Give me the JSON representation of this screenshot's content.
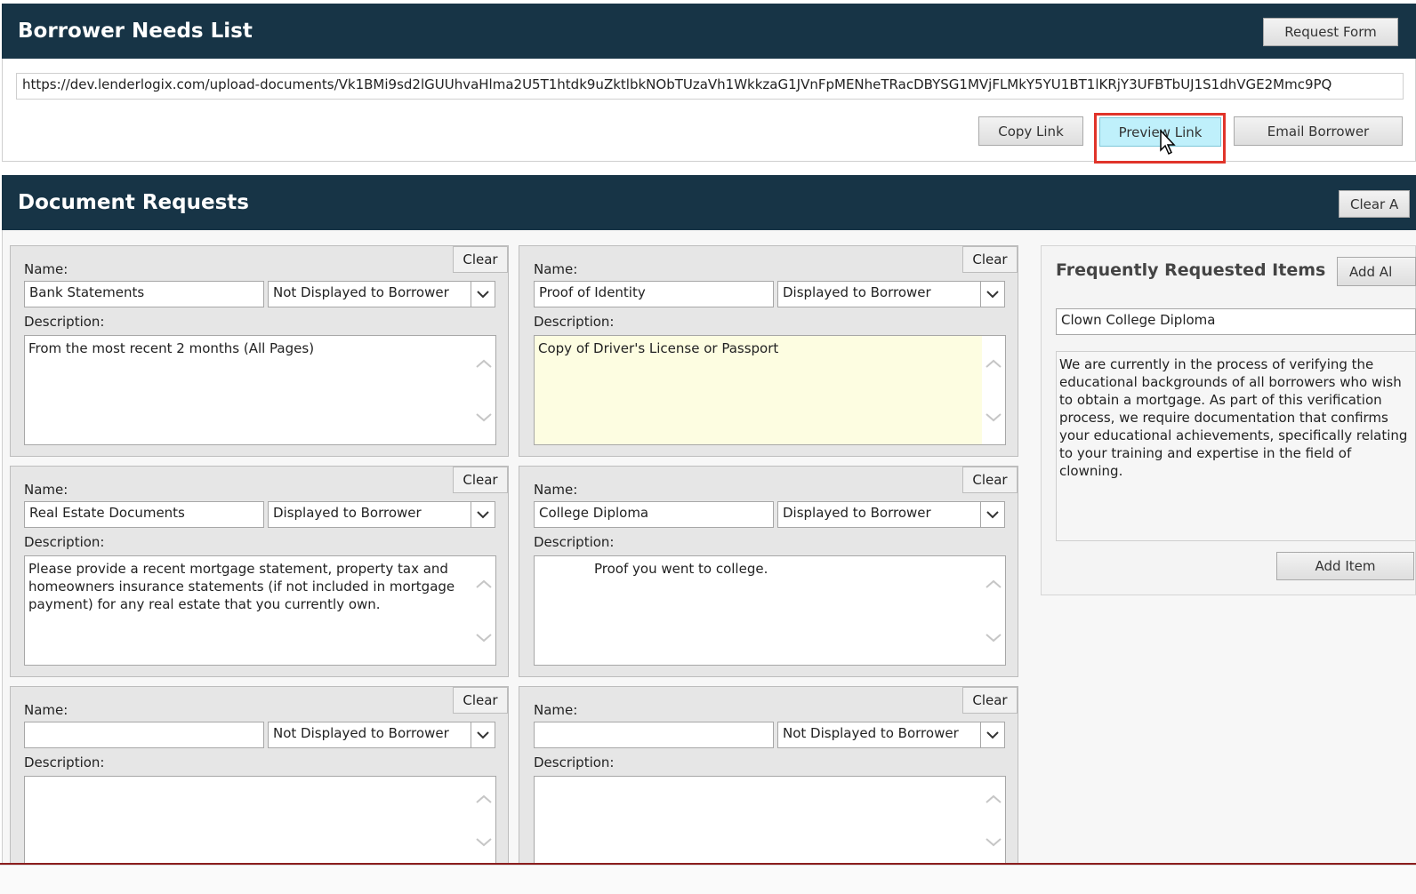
{
  "needs_list": {
    "title": "Borrower Needs List",
    "request_form_label": "Request Form",
    "url": "https://dev.lenderlogix.com/upload-documents/Vk1BMi9sd2lGUUhvaHlma2U5T1htdk9uZktlbkNObTUzaVh1WkkzaG1JVnFpMENheTRacDBYSG1MVjFLMkY5YU1BT1lKRjY3UFBTbUJ1S1dhVGE2Mmc9PQ",
    "copy_link_label": "Copy Link",
    "preview_link_label": "Preview Link",
    "email_borrower_label": "Email Borrower"
  },
  "doc_requests": {
    "title": "Document Requests",
    "clear_all_label": "Clear A",
    "cards": [
      {
        "name_label": "Name:",
        "name": "Bank Statements",
        "display": "Not Displayed to Borrower",
        "desc_label": "Description:",
        "description": "From the most recent 2 months (All Pages)",
        "clear_label": "Clear",
        "highlight": false
      },
      {
        "name_label": "Name:",
        "name": "Proof of Identity",
        "display": "Displayed to Borrower",
        "desc_label": "Description:",
        "description": "Copy of Driver's License or Passport",
        "clear_label": "Clear",
        "highlight": true
      },
      {
        "name_label": "Name:",
        "name": "Real Estate Documents",
        "display": "Displayed to Borrower",
        "desc_label": "Description:",
        "description": "Please provide a recent mortgage statement, property tax and homeowners insurance statements (if not included in mortgage payment) for any real estate that you currently own.",
        "clear_label": "Clear",
        "highlight": false
      },
      {
        "name_label": "Name:",
        "name": "College Diploma",
        "display": "Displayed to Borrower",
        "desc_label": "Description:",
        "description": "Proof you went to college.",
        "clear_label": "Clear",
        "highlight": false
      },
      {
        "name_label": "Name:",
        "name": "",
        "display": "Not Displayed to Borrower",
        "desc_label": "Description:",
        "description": "",
        "clear_label": "Clear",
        "highlight": false
      },
      {
        "name_label": "Name:",
        "name": "",
        "display": "Not Displayed to Borrower",
        "desc_label": "Description:",
        "description": "",
        "clear_label": "Clear",
        "highlight": false
      }
    ]
  },
  "frequent": {
    "title": "Frequently Requested Items",
    "add_all_label": "Add Al",
    "selected": "Clown College Diploma",
    "description": "We are currently in the process of verifying the educational backgrounds of all borrowers who wish to obtain a mortgage. As part of this verification process, we require documentation that confirms your educational achievements, specifically relating to your training and expertise in the field of clowning.",
    "add_item_label": "Add Item"
  },
  "colors": {
    "header_bg": "#173446",
    "highlight_outline": "#e0342a",
    "preview_bg": "#bff0fb",
    "yellow_field": "#fdfde1"
  }
}
